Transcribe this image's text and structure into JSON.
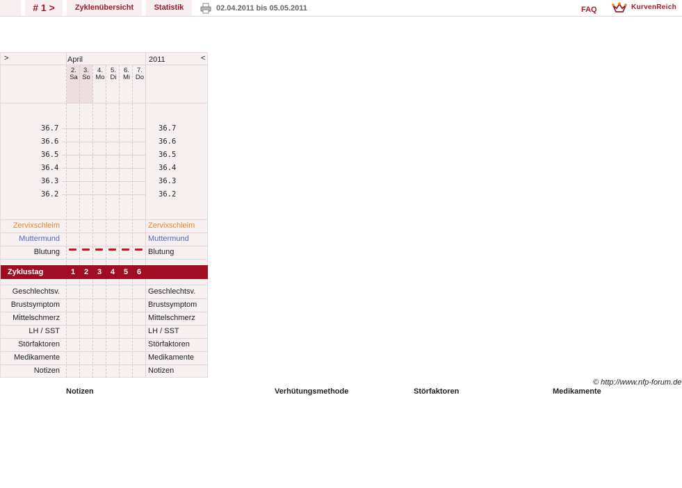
{
  "topbar": {
    "cycle_tab": "# 1 >",
    "overview_tab": "Zyklenübersicht",
    "stats_tab": "Statistik",
    "date_range": "02.04.2011 bis 05.05.2011",
    "faq": "FAQ",
    "brand": "KurvenReich",
    "accent_color": "#9b1b2e"
  },
  "chart": {
    "prev_arrow": ">",
    "next_arrow": "<",
    "month": "April",
    "year": "2011",
    "days": [
      {
        "num": "2.",
        "weekday": "Sa"
      },
      {
        "num": "3.",
        "weekday": "So"
      },
      {
        "num": "4.",
        "weekday": "Mo"
      },
      {
        "num": "5.",
        "weekday": "Di"
      },
      {
        "num": "6.",
        "weekday": "Mi"
      },
      {
        "num": "7.",
        "weekday": "Do"
      }
    ],
    "temperatures": [
      "36.7",
      "36.6",
      "36.5",
      "36.4",
      "36.3",
      "36.2"
    ],
    "rows": {
      "zervix": "Zervixschleim",
      "muttermund": "Muttermund",
      "blutung": "Blutung",
      "zyklustag": "Zyklustag",
      "geschlechtsv": "Geschlechtsv.",
      "brustsymptom": "Brustsymptom",
      "mittelschmerz": "Mittelschmerz",
      "lh": "LH / SST",
      "stoerfaktoren": "Störfaktoren",
      "medikamente": "Medikamente",
      "notizen": "Notizen"
    },
    "cycle_days": [
      "1",
      "2",
      "3",
      "4",
      "5",
      "6"
    ]
  },
  "footer": {
    "copyright": "© http://www.nfp-forum.de",
    "headings": [
      "Notizen",
      "Verhütungsmethode",
      "Störfaktoren",
      "Medikamente"
    ]
  }
}
